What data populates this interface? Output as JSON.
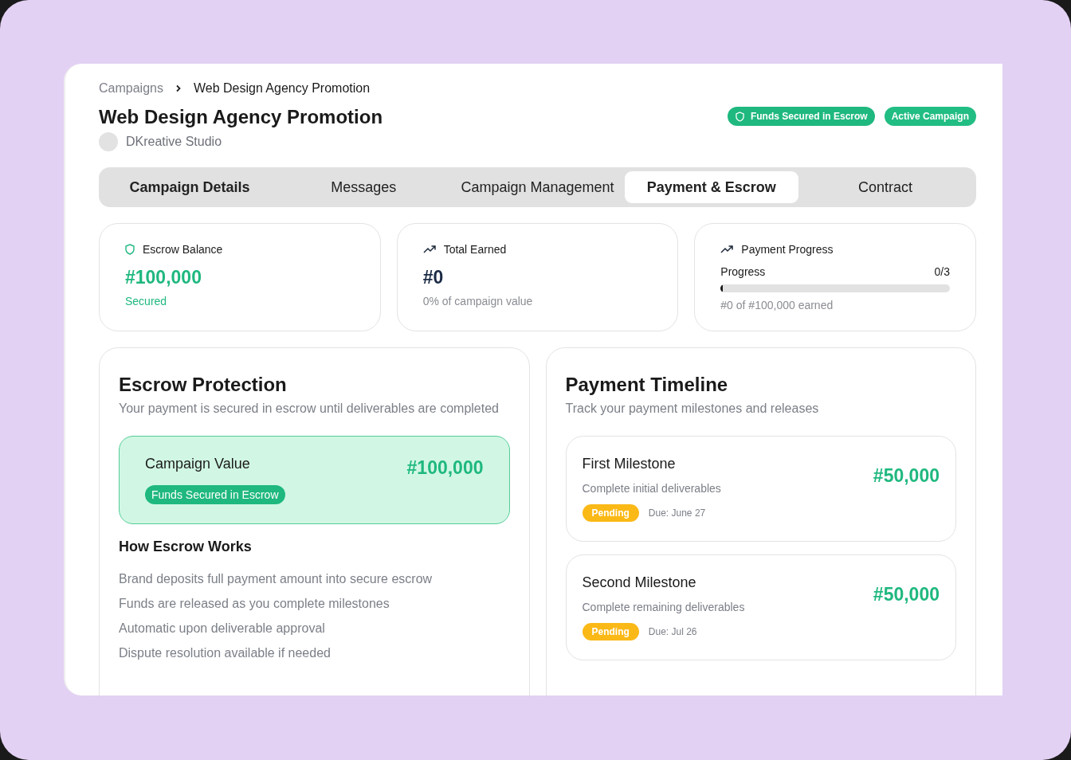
{
  "breadcrumb": [
    "Campaigns",
    "Web Design Agency Promotion"
  ],
  "title": "Web Design Agency Promotion",
  "brand": "DKreative Studio",
  "badges": [
    {
      "label": "Funds Secured in Escrow",
      "kind": "secured"
    },
    {
      "label": "Active Campaign",
      "kind": "active"
    }
  ],
  "tabs": [
    {
      "label": "Campaign Details",
      "selected": false
    },
    {
      "label": "Messages",
      "selected": false
    },
    {
      "label": "Campaign Management",
      "selected": false
    },
    {
      "label": "Payment & Escrow",
      "selected": true
    },
    {
      "label": "Contract",
      "selected": false
    }
  ],
  "stats": [
    {
      "kind": "balance",
      "title": "Escrow Balance",
      "value": "#100,000",
      "note": "Secured"
    },
    {
      "kind": "earned",
      "title": "Total Earned",
      "value": "#0",
      "note": "0% of campaign value"
    },
    {
      "kind": "progress",
      "title": "Payment Progress",
      "label": "Progress",
      "count": "0/3",
      "level": 0,
      "note": "#0 of #100,000 earned"
    }
  ],
  "escrow": {
    "title": "Escrow Protection",
    "subtitle": "Your payment is secured in escrow until deliverables are completed",
    "value_label": "Campaign Value",
    "value": "#100,000",
    "tag": "Funds Secured in Escrow",
    "how_title": "How Escrow Works",
    "steps": [
      "Brand deposits full payment amount into secure escrow",
      "Funds are released as you complete milestones",
      "Automatic upon deliverable approval",
      "Dispute resolution available if needed"
    ]
  },
  "timeline": {
    "title": "Payment Timeline",
    "subtitle": "Track your payment milestones and releases",
    "milestones": [
      {
        "name": "First Milestone",
        "description": "Complete initial deliverables",
        "status": "Pending",
        "kind": "pending",
        "due": "Due: June 27",
        "amount": "#50,000"
      },
      {
        "name": "Second Milestone",
        "description": "Complete remaining deliverables",
        "status": "Pending",
        "kind": "pending",
        "due": "Due: Jul 26",
        "amount": "#50,000"
      }
    ]
  }
}
